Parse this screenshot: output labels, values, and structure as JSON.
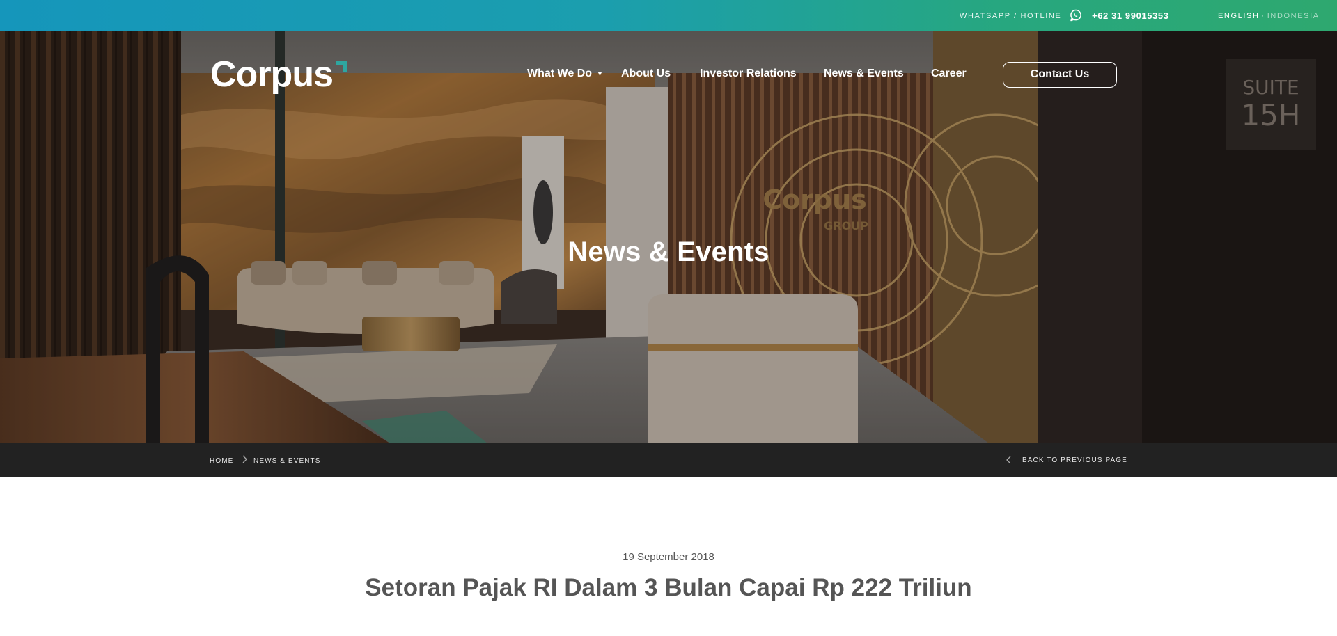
{
  "topbar": {
    "hotline_label": "WHATSAPP / HOTLINE",
    "whatsapp_icon": "whatsapp-icon",
    "phone": "+62 31 99015353",
    "lang_active": "ENGLISH",
    "lang_separator": "·",
    "lang_inactive": "INDONESIA"
  },
  "brand": {
    "logo_text": "Corpus",
    "accent_color": "#2ea6a0"
  },
  "nav": {
    "items": [
      {
        "label": "What We Do",
        "has_dropdown": true
      },
      {
        "label": "About Us"
      },
      {
        "label": "Investor Relations"
      },
      {
        "label": "News & Events"
      },
      {
        "label": "Career"
      }
    ],
    "cta": "Contact Us"
  },
  "hero": {
    "title": "News & Events"
  },
  "breadcrumb": {
    "items": [
      "HOME",
      "NEWS & EVENTS"
    ],
    "back_label": "BACK TO PREVIOUS PAGE"
  },
  "article": {
    "date": "19 September 2018",
    "title": "Setoran Pajak RI Dalam 3 Bulan Capai Rp 222 Triliun"
  }
}
